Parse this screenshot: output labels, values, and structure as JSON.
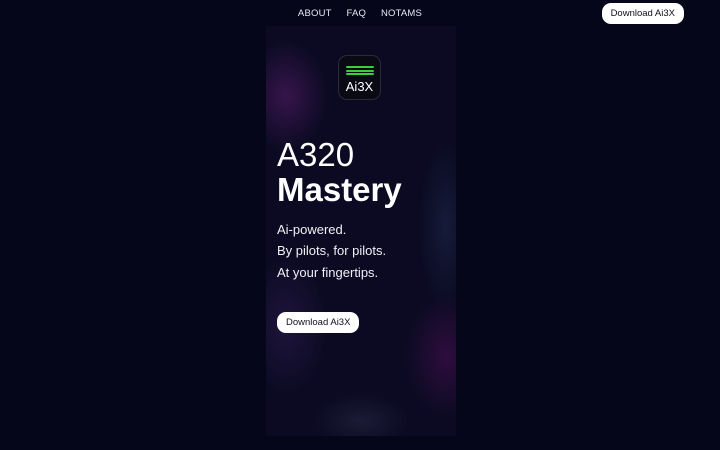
{
  "nav": {
    "links": [
      "ABOUT",
      "FAQ",
      "NOTAMS"
    ],
    "cta_label": "Download Ai3X"
  },
  "logo": {
    "text": "Ai3X",
    "bar_color": "#35d236"
  },
  "hero": {
    "title_line1": "A320",
    "title_line2": "Mastery",
    "taglines": [
      "Ai-powered.",
      "By pilots, for pilots.",
      "At your fingertips."
    ],
    "cta_label": "Download Ai3X"
  },
  "colors": {
    "background": "#06061a",
    "panel": "#0b0a22",
    "button_bg": "#ffffff",
    "button_text": "#101018"
  }
}
